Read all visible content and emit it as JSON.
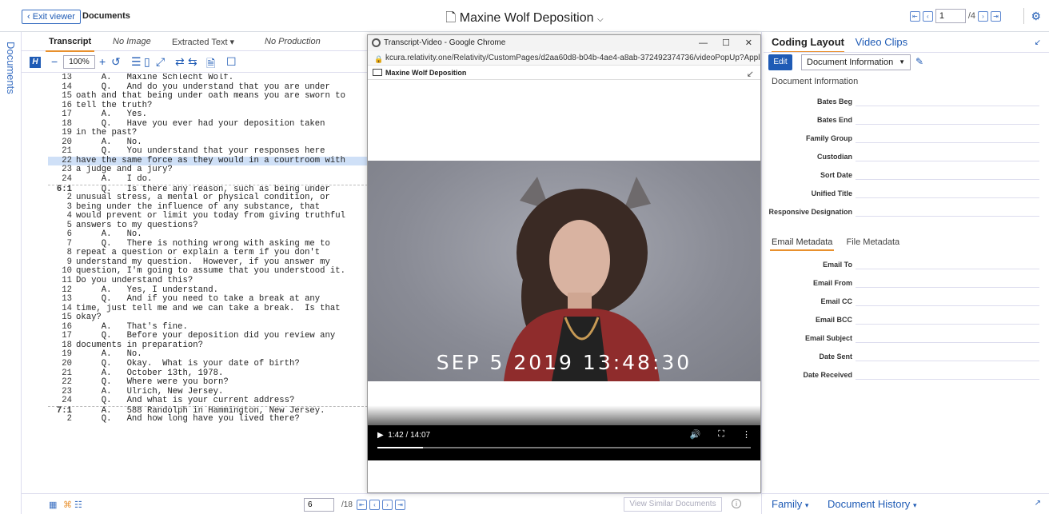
{
  "header": {
    "exit_label": "Exit viewer",
    "documents_label": "Documents",
    "doc_title": "Maxine Wolf Deposition",
    "page_current": "1",
    "page_total": "/4"
  },
  "siderail": {
    "label": "Documents"
  },
  "viewer_tabs": [
    {
      "label": "Transcript"
    },
    {
      "label": "No Image"
    },
    {
      "label": "Extracted Text"
    },
    {
      "label": "No Production"
    }
  ],
  "toolbar": {
    "zoom": "100%"
  },
  "transcript": [
    {
      "n": "13",
      "t": "     A.   Maxine Schlecht Wolf."
    },
    {
      "n": "14",
      "t": "     Q.   And do you understand that you are under"
    },
    {
      "n": "15",
      "t": "oath and that being under oath means you are sworn to"
    },
    {
      "n": "16",
      "t": "tell the truth?"
    },
    {
      "n": "17",
      "t": "     A.   Yes."
    },
    {
      "n": "18",
      "t": "     Q.   Have you ever had your deposition taken"
    },
    {
      "n": "19",
      "t": "in the past?"
    },
    {
      "n": "20",
      "t": "     A.   No."
    },
    {
      "n": "21",
      "t": "     Q.   You understand that your responses here"
    },
    {
      "n": "22",
      "t": "have the same force as they would in a courtroom with",
      "hl": true
    },
    {
      "n": "23",
      "t": "a judge and a jury?"
    },
    {
      "n": "24",
      "t": "     A.   I do."
    },
    {
      "n": "6:1",
      "t": "     Q.   Is there any reason, such as being under",
      "pg": true
    },
    {
      "n": "2",
      "t": "unusual stress, a mental or physical condition, or"
    },
    {
      "n": "3",
      "t": "being under the influence of any substance, that"
    },
    {
      "n": "4",
      "t": "would prevent or limit you today from giving truthful"
    },
    {
      "n": "5",
      "t": "answers to my questions?"
    },
    {
      "n": "6",
      "t": "     A.   No."
    },
    {
      "n": "7",
      "t": "     Q.   There is nothing wrong with asking me to"
    },
    {
      "n": "8",
      "t": "repeat a question or explain a term if you don't"
    },
    {
      "n": "9",
      "t": "understand my question.  However, if you answer my"
    },
    {
      "n": "10",
      "t": "question, I'm going to assume that you understood it."
    },
    {
      "n": "11",
      "t": "Do you understand this?"
    },
    {
      "n": "12",
      "t": "     A.   Yes, I understand."
    },
    {
      "n": "13",
      "t": "     Q.   And if you need to take a break at any"
    },
    {
      "n": "14",
      "t": "time, just tell me and we can take a break.  Is that"
    },
    {
      "n": "15",
      "t": "okay?"
    },
    {
      "n": "16",
      "t": "     A.   That's fine."
    },
    {
      "n": "17",
      "t": "     Q.   Before your deposition did you review any"
    },
    {
      "n": "18",
      "t": "documents in preparation?"
    },
    {
      "n": "19",
      "t": "     A.   No."
    },
    {
      "n": "20",
      "t": "     Q.   Okay.  What is your date of birth?"
    },
    {
      "n": "21",
      "t": "     A.   October 13th, 1978."
    },
    {
      "n": "22",
      "t": "     Q.   Where were you born?"
    },
    {
      "n": "23",
      "t": "     A.   Ulrich, New Jersey."
    },
    {
      "n": "24",
      "t": "     Q.   And what is your current address?"
    },
    {
      "n": "7:1",
      "t": "     A.   588 Randolph in Hammington, New Jersey.",
      "pg": true
    },
    {
      "n": "2",
      "t": "     Q.   And how long have you lived there?"
    }
  ],
  "bottom": {
    "page": "6",
    "total": "/18",
    "view_similar": "View Similar Documents"
  },
  "popup": {
    "window_title": "Transcript-Video - Google Chrome",
    "url": "kcura.relativity.one/Relativity/CustomPages/d2aa60d8-b04b-4ae4-a8ab-372492374736/videoPopUp?Appl...",
    "sub_title": "Maxine Wolf Deposition",
    "video_timestamp": "SEP  5 2019 13:48:30",
    "time": "1:42 / 14:07",
    "progress": 0.121
  },
  "coding": {
    "tab1": "Coding Layout",
    "tab2": "Video Clips",
    "edit": "Edit",
    "layout": "Document Information",
    "section": "Document Information",
    "fields": [
      "Bates Beg",
      "Bates End",
      "Family Group",
      "Custodian",
      "Sort Date",
      "Unified Title",
      "Responsive Designation"
    ],
    "subtab1": "Email Metadata",
    "subtab2": "File Metadata",
    "email_fields": [
      "Email To",
      "Email From",
      "Email CC",
      "Email BCC",
      "Email Subject",
      "Date Sent",
      "Date Received"
    ]
  },
  "rbottom": {
    "family": "Family",
    "history": "Document History"
  }
}
